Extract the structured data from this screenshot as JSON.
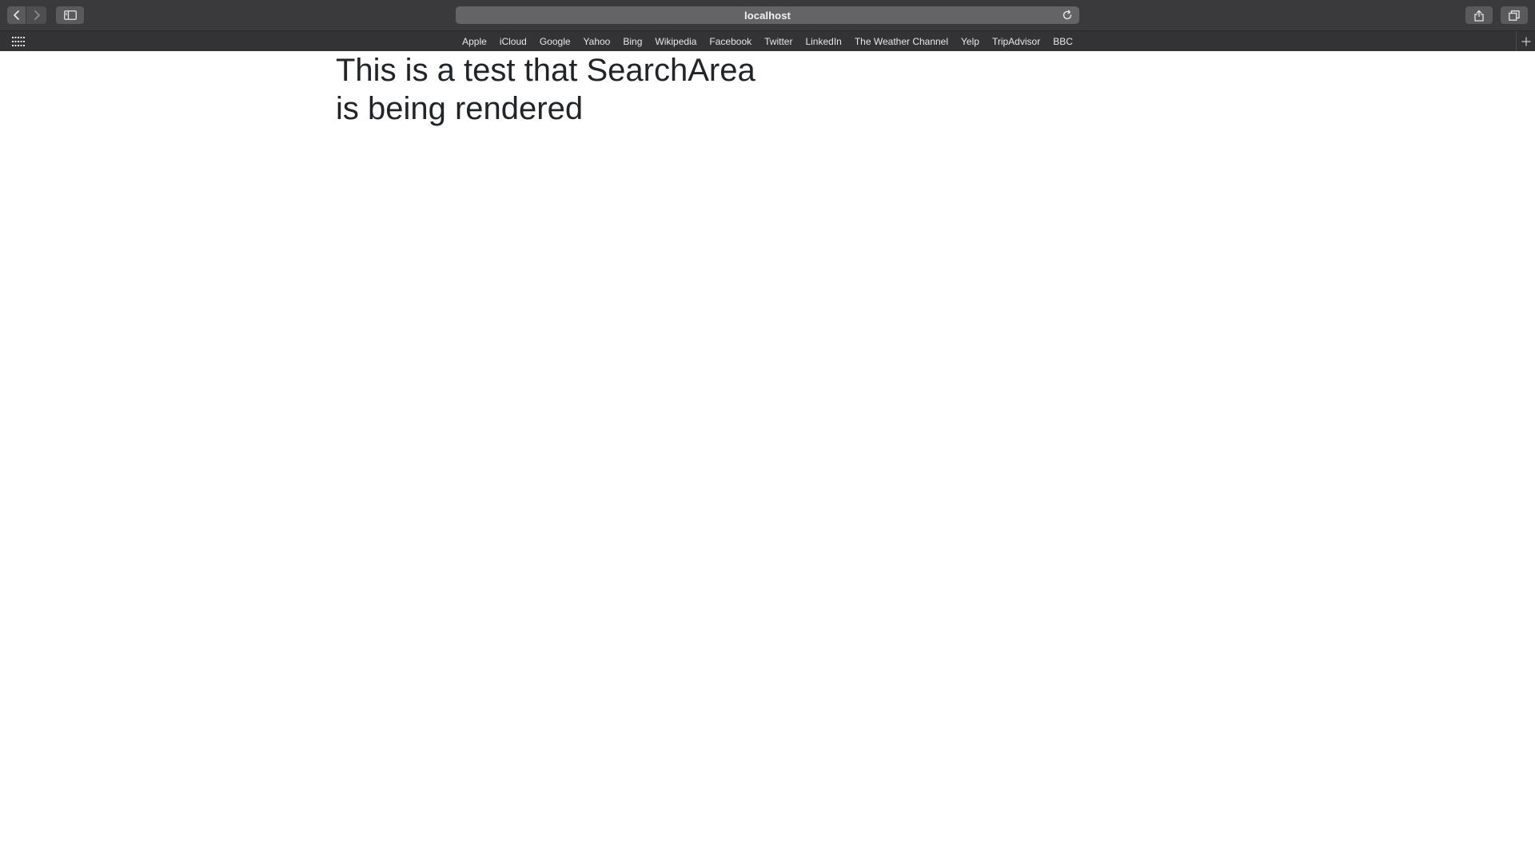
{
  "browser": {
    "address": "localhost",
    "bookmarks": [
      {
        "label": "Apple"
      },
      {
        "label": "iCloud"
      },
      {
        "label": "Google"
      },
      {
        "label": "Yahoo"
      },
      {
        "label": "Bing"
      },
      {
        "label": "Wikipedia"
      },
      {
        "label": "Facebook"
      },
      {
        "label": "Twitter"
      },
      {
        "label": "LinkedIn"
      },
      {
        "label": "The Weather Channel"
      },
      {
        "label": "Yelp"
      },
      {
        "label": "TripAdvisor"
      },
      {
        "label": "BBC"
      }
    ],
    "icons": {
      "back": "chevron-left-icon",
      "forward": "chevron-right-icon",
      "sidebar": "sidebar-icon",
      "reload": "reload-icon",
      "share": "share-icon",
      "tabs": "tabs-overview-icon",
      "grid": "grid-icon",
      "new_tab": "plus-icon"
    },
    "colors": {
      "toolbar": "#3a3a3c",
      "bookmarks_bar": "#333335",
      "address_bar": "#646466",
      "text_light": "#f2f2f2"
    }
  },
  "page": {
    "heading": "This is a test that SearchArea is being rendered",
    "heading_color": "#212529",
    "background": "#ffffff"
  }
}
